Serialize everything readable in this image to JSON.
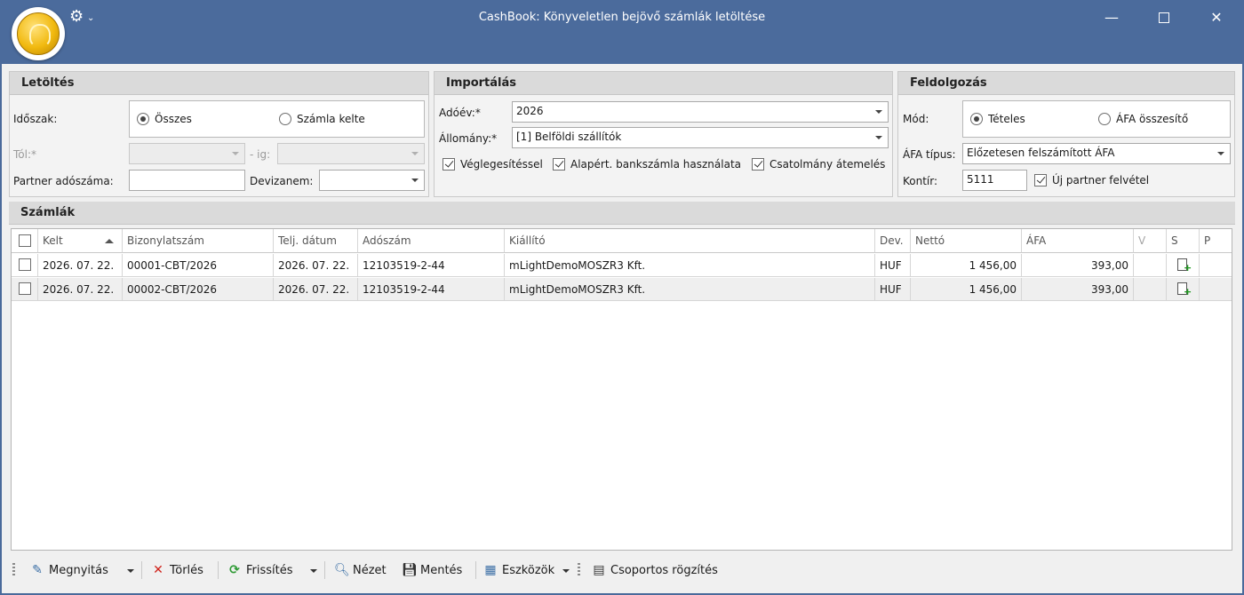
{
  "window": {
    "title": "CashBook: Könyveletlen bejövő számlák letöltése",
    "icons": {
      "logo": "gold-coin-logo",
      "settings": "gear-icon",
      "minimize": "minimize-icon",
      "maximize": "maximize-icon",
      "close": "close-icon"
    },
    "close_glyph": "✕"
  },
  "letoltes": {
    "title": "Letöltés",
    "idoszak_label": "Időszak:",
    "options": [
      "Összes",
      "Számla kelte"
    ],
    "selected": "Összes",
    "tol_label": "Tól:*",
    "ig_label": "- ig:",
    "partner_label": "Partner adószáma:",
    "partner_value": "",
    "devizanem_label": "Devizanem:",
    "devizanem_value": ""
  },
  "importalas": {
    "title": "Importálás",
    "adoev_label": "Adóév:*",
    "adoev_value": "2026",
    "allomany_label": "Állomány:*",
    "allomany_value": "[1] Belföldi szállítók",
    "checks": [
      {
        "label": "Véglegesítéssel",
        "checked": true
      },
      {
        "label": "Alapért. bankszámla használata",
        "checked": true
      },
      {
        "label": "Csatolmány átemelés",
        "checked": true
      }
    ]
  },
  "feldolgozas": {
    "title": "Feldolgozás",
    "mod_label": "Mód:",
    "options": [
      "Tételes",
      "ÁFA összesítő"
    ],
    "selected": "Tételes",
    "afa_tipus_label": "ÁFA típus:",
    "afa_tipus_value": "Előzetesen felszámított ÁFA",
    "kontir_label": "Kontír:",
    "kontir_value": "5111",
    "uj_partner_label": "Új partner felvétel",
    "uj_partner_checked": true
  },
  "szamlak": {
    "title": "Számlák",
    "columns": [
      "Kelt",
      "Bizonylatszám",
      "Telj. dátum",
      "Adószám",
      "Kiállító",
      "Dev.",
      "Nettó",
      "ÁFA",
      "V",
      "S",
      "P"
    ],
    "rows": [
      {
        "kelt": "2026. 07. 22.",
        "bizonylatszam": "00001-CBT/2026",
        "telj_datum": "2026. 07. 22.",
        "adoszam": "12103519-2-44",
        "kiallito": "mLightDemoMOSZR3 Kft.",
        "dev": "HUF",
        "netto": "1 456,00",
        "afa": "393,00"
      },
      {
        "kelt": "2026. 07. 22.",
        "bizonylatszam": "00002-CBT/2026",
        "telj_datum": "2026. 07. 22.",
        "adoszam": "12103519-2-44",
        "kiallito": "mLightDemoMOSZR3 Kft.",
        "dev": "HUF",
        "netto": "1 456,00",
        "afa": "393,00"
      }
    ]
  },
  "toolbar": {
    "megnyitas": "Megnyitás",
    "torles": "Törlés",
    "frissites": "Frissítés",
    "nezet": "Nézet",
    "mentes": "Mentés",
    "eszkozok": "Eszközök",
    "csoportos_rogzites": "Csoportos rögzítés"
  }
}
